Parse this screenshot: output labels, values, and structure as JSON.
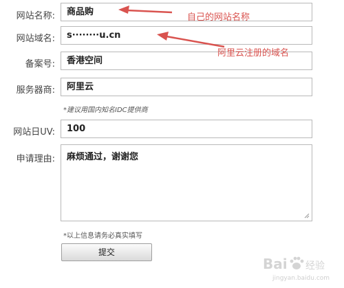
{
  "form": {
    "site_name": {
      "label": "网站名称:",
      "value": "商品购"
    },
    "site_domain": {
      "label": "网站域名:",
      "value": "s········u.cn"
    },
    "record_no": {
      "label": "备案号:",
      "value": "香港空间"
    },
    "provider": {
      "label": "服务器商:",
      "value": "阿里云"
    },
    "provider_hint": "*建议用国内知名IDC提供商",
    "daily_uv": {
      "label": "网站日UV:",
      "value": "100"
    },
    "reason": {
      "label": "申请理由:",
      "value": "麻烦通过，谢谢您"
    },
    "footer_note": "*以上信息请务必真实填写",
    "submit_label": "提交"
  },
  "annotations": {
    "site_name_note": "自己的网站名称",
    "domain_note": "阿里云注册的域名",
    "color": "#d9534f"
  },
  "watermark": {
    "brand": "Bai",
    "suffix": "经验",
    "url": "jingyan.baidu.com"
  }
}
